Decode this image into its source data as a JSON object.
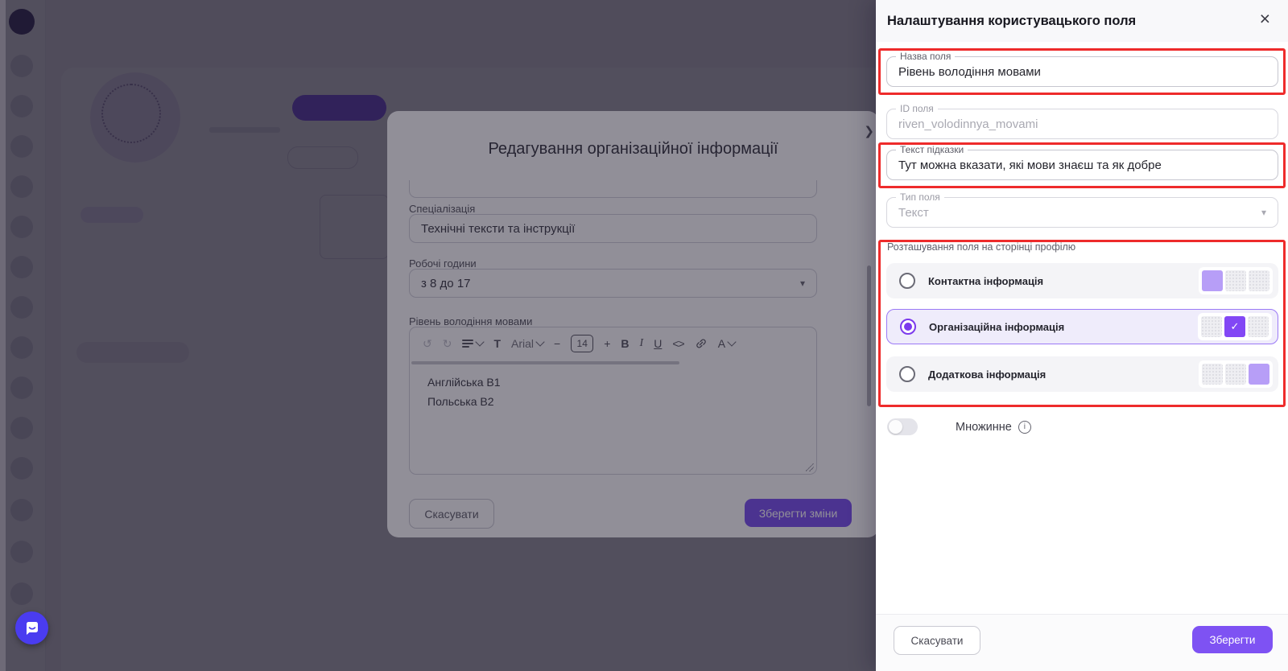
{
  "icons": {
    "close": "×",
    "chevron_right": "❯",
    "caret_down": "▾",
    "check": "✓",
    "undo": "↺",
    "redo": "↻",
    "info": "i"
  },
  "panel": {
    "title": "Налаштування користувацького поля",
    "name_field": {
      "label": "Назва поля",
      "value": "Рівень володіння мовами"
    },
    "id_field": {
      "label": "ID поля",
      "value": "riven_volodinnya_movami"
    },
    "hint_field": {
      "label": "Текст підказки",
      "value": "Тут можна вказати, які мови знаєш та як добре"
    },
    "type_field": {
      "label": "Тип поля",
      "value": "Текст"
    },
    "placement": {
      "label": "Розташування поля на сторінці профілю",
      "options": [
        {
          "label": "Контактна інформація"
        },
        {
          "label": "Організаційна інформація"
        },
        {
          "label": "Додаткова інформація"
        }
      ],
      "selected": "Організаційна інформація"
    },
    "multiple_toggle": {
      "label": "Множинне",
      "state": "off"
    },
    "cancel_label": "Скасувати",
    "save_label": "Зберегти"
  },
  "modal": {
    "title": "Редагування організаційної інформації",
    "specialization": {
      "label": "Спеціалізація",
      "value": "Технічні тексти та інструкції"
    },
    "working_hours": {
      "label": "Робочі години",
      "value": "з 8 до 17"
    },
    "languages": {
      "label": "Рівень володіння мовами",
      "content": [
        "Англійська B1",
        "Польська B2"
      ]
    },
    "toolbar": {
      "text": "T",
      "font": "Arial",
      "minus": "−",
      "size": "14",
      "plus": "+",
      "bold": "B",
      "italic": "I",
      "underline": "U",
      "code": "<>",
      "color": "A"
    },
    "cancel_label": "Скасувати",
    "save_label": "Зберегти зміни"
  },
  "colors": {
    "accent_purple": "#7A4FF0",
    "save_button": "#7E52F3",
    "annotation_red": "#EE2B2B",
    "selected_row_border": "#9B79F6",
    "lavender_block": "#B79EF7",
    "checked_block": "#8247F5",
    "chat_bubble": "#4A3CF0"
  }
}
